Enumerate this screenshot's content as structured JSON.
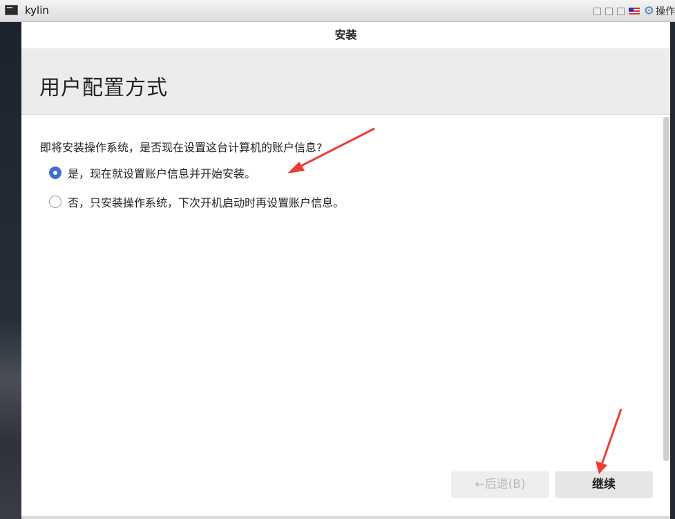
{
  "vm": {
    "title": "kylin",
    "ops_label": "操作",
    "icons": [
      "terminal-icon",
      "restore-icon",
      "minimize-icon",
      "maximize-icon",
      "us-flag-icon",
      "gear-icon"
    ]
  },
  "window": {
    "title": "安装"
  },
  "page": {
    "heading": "用户配置方式",
    "question": "即将安装操作系统，是否现在设置这台计算机的账户信息?",
    "options": [
      {
        "label": "是，现在就设置账户信息并开始安装。",
        "selected": true
      },
      {
        "label": "否，只安装操作系统，下次开机启动时再设置账户信息。",
        "selected": false
      }
    ]
  },
  "buttons": {
    "back": "←后退(B)",
    "back_enabled": false,
    "next": "继续"
  },
  "colors": {
    "accent": "#3e6ed5",
    "annotation_arrow": "#ee3b36"
  }
}
